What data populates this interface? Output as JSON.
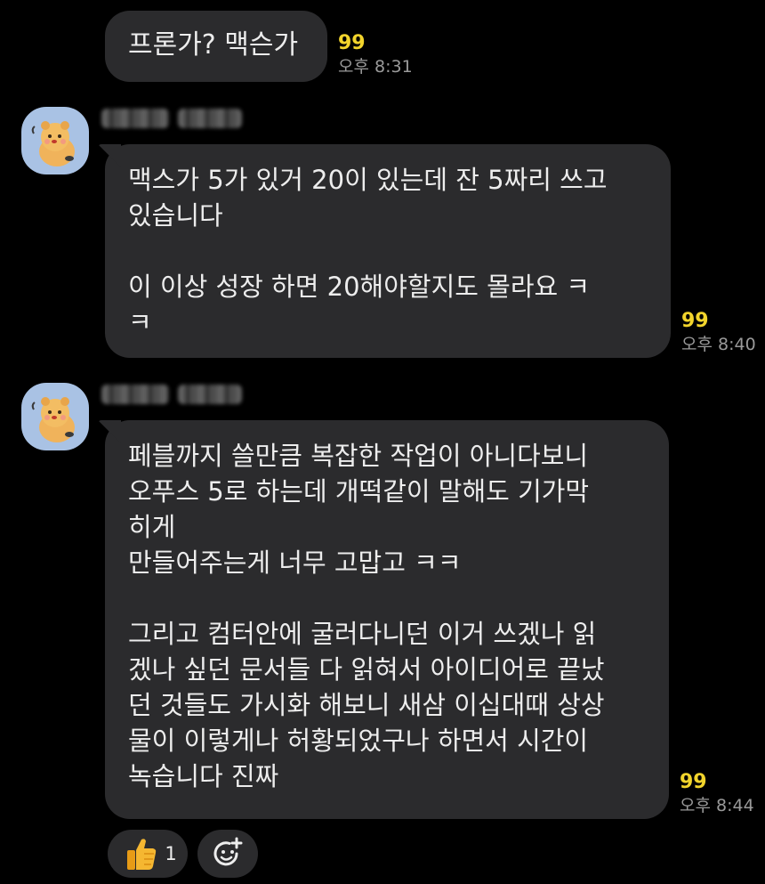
{
  "messages": [
    {
      "text": "프론가? 맥슨가",
      "unread_count": "99",
      "time": "오후 8:31"
    },
    {
      "text": "맥스가 5가 있거 20이 있는데 잔 5짜리 쓰고\n있습니다\n\n이 이상 성장 하면 20해야할지도 몰라요 ㅋ\nㅋ",
      "unread_count": "99",
      "time": "오후 8:40"
    },
    {
      "text": "페블까지 쓸만큼 복잡한 작업이 아니다보니\n오푸스 5로 하는데 개떡같이 말해도 기가막\n히게\n만들어주는게 너무 고맙고 ㅋㅋ\n\n그리고 컴터안에 굴러다니던 이거 쓰겠나 읽\n겠나 싶던 문서들 다 읽혀서 아이디어로 끝났\n던 것들도 가시화 해보니 새삼 이십대때 상상\n물이 이렇게나 허황되었구나 하면서 시간이\n녹습니다 진짜",
      "unread_count": "99",
      "time": "오후 8:44"
    }
  ],
  "reactions": {
    "like_count": "1"
  },
  "colors": {
    "background": "#000000",
    "bubble": "#2b2b2d",
    "unread": "#f2d42c",
    "time": "#9a9a9a"
  }
}
